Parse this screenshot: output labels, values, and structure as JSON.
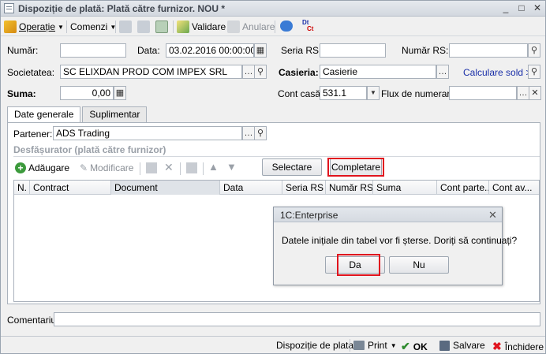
{
  "window": {
    "title": "Dispoziție de plată: Plată către furnizor. NOU *",
    "controls": [
      "_",
      "□",
      "✕"
    ]
  },
  "toolbar": {
    "operatie": "Operație",
    "comenzi": "Comenzi",
    "validare": "Validare",
    "anulare": "Anulare",
    "dtct_top": "Dt",
    "dtct_bottom": "Ct"
  },
  "form": {
    "numar_label": "Număr:",
    "numar_value": "",
    "data_label": "Data:",
    "data_value": "03.02.2016 00:00:00",
    "seria_rs_label": "Seria RS:",
    "seria_rs_value": "",
    "numar_rs_label": "Număr RS:",
    "numar_rs_value": "",
    "societatea_label": "Societatea:",
    "societatea_value": "SC ELIXDAN PROD COM IMPEX SRL",
    "casieria_label": "Casieria:",
    "casieria_value": "Casierie",
    "calculare_link": "Calculare sold >>",
    "suma_label": "Suma:",
    "suma_value": "0,00",
    "cont_casa_label": "Cont casă:",
    "cont_casa_value": "531.1",
    "flux_label": "Flux de numerar:",
    "flux_value": ""
  },
  "tabs": [
    "Date generale",
    "Suplimentar"
  ],
  "partener": {
    "label": "Partener:",
    "value": "ADS Trading"
  },
  "section_title": "Desfășurator (plată către furnizor)",
  "grid_toolbar": {
    "adaugare": "Adăugare",
    "modificare": "Modificare",
    "selectare": "Selectare",
    "completare": "Completare"
  },
  "grid": {
    "columns": [
      "N.",
      "Contract",
      "Document",
      "Data",
      "Seria RS",
      "Număr RS",
      "Suma",
      "Cont parte...",
      "Cont av..."
    ]
  },
  "dialog": {
    "title": "1C:Enterprise",
    "message": "Datele inițiale din tabel vor fi șterse. Doriți să continuați?",
    "yes": "Da",
    "no": "Nu"
  },
  "comment": {
    "label": "Comentariu:",
    "value": ""
  },
  "footer": {
    "dispozitie": "Dispoziție de plata",
    "print": "Print",
    "ok": "OK",
    "salvare": "Salvare",
    "inchidere": "Închidere"
  },
  "colors": {
    "accent_red": "#e0141e",
    "link_blue": "#1a2fa8",
    "ok_green": "#2e8b2e"
  }
}
